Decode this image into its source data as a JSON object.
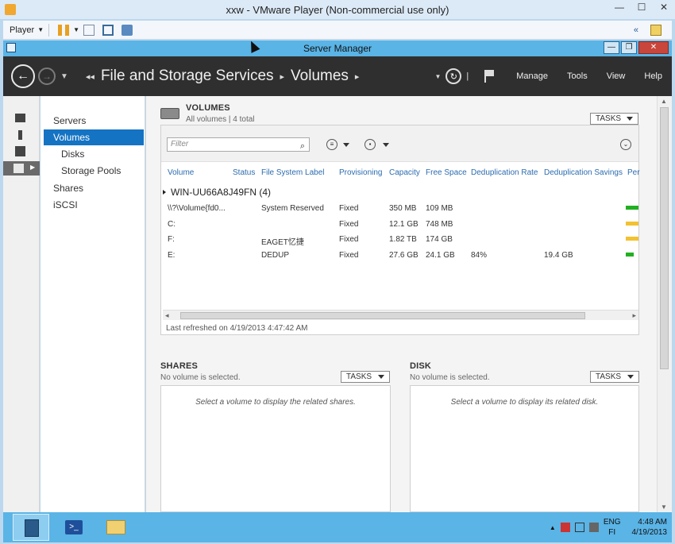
{
  "vmware": {
    "title": "xxw - VMware Player (Non-commercial use only)",
    "player_menu": "Player"
  },
  "server_manager": {
    "title": "Server Manager",
    "breadcrumb": [
      "File and Storage Services",
      "Volumes"
    ],
    "menu": [
      "Manage",
      "Tools",
      "View",
      "Help"
    ]
  },
  "nav": {
    "items": [
      {
        "label": "Servers",
        "sub": false,
        "selected": false
      },
      {
        "label": "Volumes",
        "sub": false,
        "selected": true
      },
      {
        "label": "Disks",
        "sub": true,
        "selected": false
      },
      {
        "label": "Storage Pools",
        "sub": true,
        "selected": false
      },
      {
        "label": "Shares",
        "sub": false,
        "selected": false
      },
      {
        "label": "iSCSI",
        "sub": false,
        "selected": false
      }
    ]
  },
  "volumes": {
    "title": "VOLUMES",
    "subtitle": "All volumes | 4 total",
    "tasks_label": "TASKS",
    "filter_placeholder": "Filter",
    "columns": [
      "Volume",
      "Status",
      "File System Label",
      "Provisioning",
      "Capacity",
      "Free Space",
      "Deduplication Rate",
      "Deduplication Savings",
      "Per"
    ],
    "group": "WIN-UU66A8J49FN (4)",
    "rows": [
      {
        "volume": "\\\\?\\Volume{fd0...",
        "status": "",
        "label": "System Reserved",
        "provisioning": "Fixed",
        "capacity": "350 MB",
        "free": "109 MB",
        "dedup_rate": "",
        "dedup_savings": "",
        "bar_color": "#22b022",
        "bar_fill": 1.0
      },
      {
        "volume": "C:",
        "status": "",
        "label": "",
        "provisioning": "Fixed",
        "capacity": "12.1 GB",
        "free": "748 MB",
        "dedup_rate": "",
        "dedup_savings": "",
        "bar_color": "#f2c230",
        "bar_fill": 1.0
      },
      {
        "volume": "F:",
        "status": "",
        "label": "EAGET忆捷",
        "provisioning": "Fixed",
        "capacity": "1.82 TB",
        "free": "174 GB",
        "dedup_rate": "",
        "dedup_savings": "",
        "bar_color": "#f2c230",
        "bar_fill": 1.0
      },
      {
        "volume": "E:",
        "status": "",
        "label": "DEDUP",
        "provisioning": "Fixed",
        "capacity": "27.6 GB",
        "free": "24.1 GB",
        "dedup_rate": "84%",
        "dedup_savings": "19.4 GB",
        "bar_color": "#22b022",
        "bar_fill": 0.6
      }
    ],
    "last_refreshed": "Last refreshed on 4/19/2013 4:47:42 AM"
  },
  "shares": {
    "title": "SHARES",
    "subtitle": "No volume is selected.",
    "tasks_label": "TASKS",
    "message": "Select a volume to display the related shares."
  },
  "disk": {
    "title": "DISK",
    "subtitle": "No volume is selected.",
    "tasks_label": "TASKS",
    "message": "Select a volume to display its related disk."
  },
  "tray": {
    "lang1": "ENG",
    "lang2": "FI",
    "time": "4:48 AM",
    "date": "4/19/2013"
  }
}
